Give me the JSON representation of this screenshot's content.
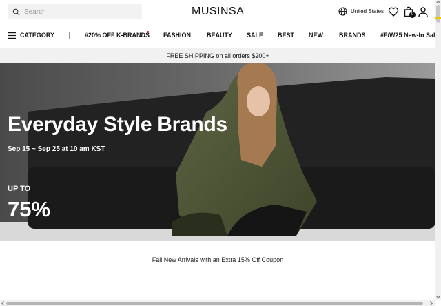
{
  "header": {
    "search_placeholder": "Search",
    "logo": "MUSINSA",
    "region": "United States",
    "cart_count": "0"
  },
  "nav": {
    "category": "CATEGORY",
    "items": [
      "#20% OFF K-BRANDS",
      "FASHION",
      "BEAUTY",
      "SALE",
      "BEST",
      "NEW",
      "BRANDS",
      "#F/W25 New-In Sal"
    ]
  },
  "shipping": "FREE SHIPPING on all orders $200+",
  "hero": {
    "title": "Everyday Style Brands",
    "dates": "Sep 15 ~ Sep 25 at 10 am KST",
    "upto": "UP TO",
    "percent": "75%"
  },
  "promo": "Fall New Arrivals with an Extra 15% Off Coupon",
  "colors": {
    "accent": "#f5c400",
    "new_dot": "#e4002b"
  }
}
